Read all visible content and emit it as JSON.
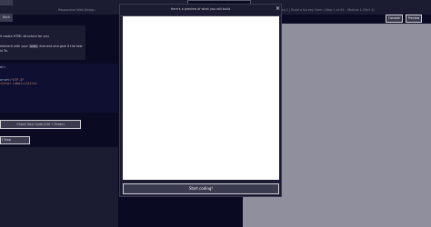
{
  "header": {
    "title": "Responsive Web Design",
    "step": "Step 1 | Build a Survey Form | Step 1 of 45 – Module 1 (Part 1)"
  },
  "toolbar": {
    "back_label": "Back",
    "console_label": "Console",
    "preview_label": "Preview"
  },
  "description": {
    "line1_before": "ll create HTML structure for you",
    "line2_before": "element with your ",
    "line2_code": "body",
    "line2_after": " element and give it the text",
    "line3": "ld To."
  },
  "editor": {
    "lines": [
      {
        "pre": "ml>",
        "tag": "",
        "str": ""
      },
      {
        "pre": "",
        "tag": "",
        "str": ""
      },
      {
        "pre": "",
        "tag": "",
        "str": ""
      },
      {
        "pre": "arset=",
        "tag": "",
        "str": "\"UTF-8\""
      },
      {
        "pre": "",
        "tag": "title",
        "str": ">Color Label</title>"
      },
      {
        "pre": "",
        "tag": "",
        "str": ""
      }
    ]
  },
  "actions": {
    "check_label": "Check Your Code (Ctrl + Enter)",
    "reset_label": "t Step"
  },
  "modal": {
    "title": "Here's a preview of what you will build",
    "close_icon": "×",
    "start_label": "Start coding!"
  },
  "colors": {
    "background": "#0a0a23",
    "panel": "#1b1b32",
    "button": "#3b3b4f",
    "preview_bg": "#8f8f9e"
  }
}
